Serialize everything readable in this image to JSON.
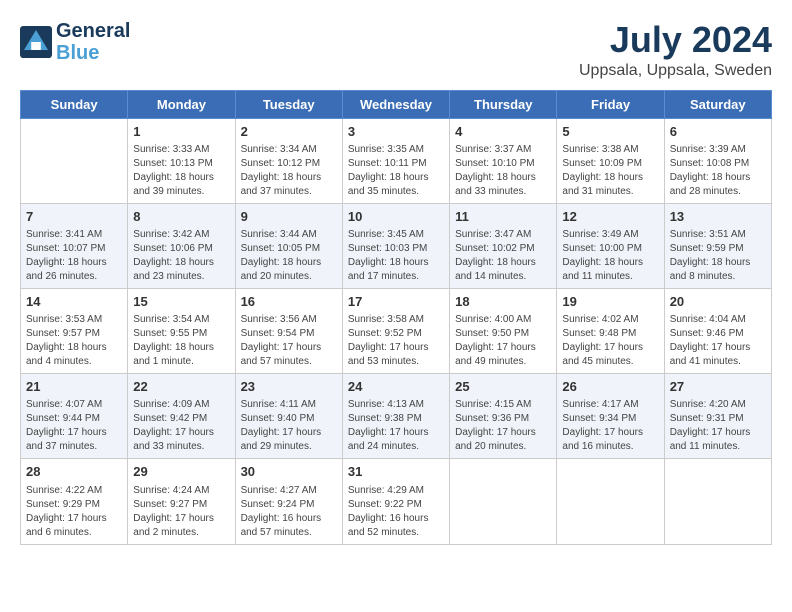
{
  "header": {
    "logo_line1": "General",
    "logo_line2": "Blue",
    "month_year": "July 2024",
    "location": "Uppsala, Uppsala, Sweden"
  },
  "weekdays": [
    "Sunday",
    "Monday",
    "Tuesday",
    "Wednesday",
    "Thursday",
    "Friday",
    "Saturday"
  ],
  "weeks": [
    [
      {
        "day": "",
        "info": ""
      },
      {
        "day": "1",
        "info": "Sunrise: 3:33 AM\nSunset: 10:13 PM\nDaylight: 18 hours\nand 39 minutes."
      },
      {
        "day": "2",
        "info": "Sunrise: 3:34 AM\nSunset: 10:12 PM\nDaylight: 18 hours\nand 37 minutes."
      },
      {
        "day": "3",
        "info": "Sunrise: 3:35 AM\nSunset: 10:11 PM\nDaylight: 18 hours\nand 35 minutes."
      },
      {
        "day": "4",
        "info": "Sunrise: 3:37 AM\nSunset: 10:10 PM\nDaylight: 18 hours\nand 33 minutes."
      },
      {
        "day": "5",
        "info": "Sunrise: 3:38 AM\nSunset: 10:09 PM\nDaylight: 18 hours\nand 31 minutes."
      },
      {
        "day": "6",
        "info": "Sunrise: 3:39 AM\nSunset: 10:08 PM\nDaylight: 18 hours\nand 28 minutes."
      }
    ],
    [
      {
        "day": "7",
        "info": "Sunrise: 3:41 AM\nSunset: 10:07 PM\nDaylight: 18 hours\nand 26 minutes."
      },
      {
        "day": "8",
        "info": "Sunrise: 3:42 AM\nSunset: 10:06 PM\nDaylight: 18 hours\nand 23 minutes."
      },
      {
        "day": "9",
        "info": "Sunrise: 3:44 AM\nSunset: 10:05 PM\nDaylight: 18 hours\nand 20 minutes."
      },
      {
        "day": "10",
        "info": "Sunrise: 3:45 AM\nSunset: 10:03 PM\nDaylight: 18 hours\nand 17 minutes."
      },
      {
        "day": "11",
        "info": "Sunrise: 3:47 AM\nSunset: 10:02 PM\nDaylight: 18 hours\nand 14 minutes."
      },
      {
        "day": "12",
        "info": "Sunrise: 3:49 AM\nSunset: 10:00 PM\nDaylight: 18 hours\nand 11 minutes."
      },
      {
        "day": "13",
        "info": "Sunrise: 3:51 AM\nSunset: 9:59 PM\nDaylight: 18 hours\nand 8 minutes."
      }
    ],
    [
      {
        "day": "14",
        "info": "Sunrise: 3:53 AM\nSunset: 9:57 PM\nDaylight: 18 hours\nand 4 minutes."
      },
      {
        "day": "15",
        "info": "Sunrise: 3:54 AM\nSunset: 9:55 PM\nDaylight: 18 hours\nand 1 minute."
      },
      {
        "day": "16",
        "info": "Sunrise: 3:56 AM\nSunset: 9:54 PM\nDaylight: 17 hours\nand 57 minutes."
      },
      {
        "day": "17",
        "info": "Sunrise: 3:58 AM\nSunset: 9:52 PM\nDaylight: 17 hours\nand 53 minutes."
      },
      {
        "day": "18",
        "info": "Sunrise: 4:00 AM\nSunset: 9:50 PM\nDaylight: 17 hours\nand 49 minutes."
      },
      {
        "day": "19",
        "info": "Sunrise: 4:02 AM\nSunset: 9:48 PM\nDaylight: 17 hours\nand 45 minutes."
      },
      {
        "day": "20",
        "info": "Sunrise: 4:04 AM\nSunset: 9:46 PM\nDaylight: 17 hours\nand 41 minutes."
      }
    ],
    [
      {
        "day": "21",
        "info": "Sunrise: 4:07 AM\nSunset: 9:44 PM\nDaylight: 17 hours\nand 37 minutes."
      },
      {
        "day": "22",
        "info": "Sunrise: 4:09 AM\nSunset: 9:42 PM\nDaylight: 17 hours\nand 33 minutes."
      },
      {
        "day": "23",
        "info": "Sunrise: 4:11 AM\nSunset: 9:40 PM\nDaylight: 17 hours\nand 29 minutes."
      },
      {
        "day": "24",
        "info": "Sunrise: 4:13 AM\nSunset: 9:38 PM\nDaylight: 17 hours\nand 24 minutes."
      },
      {
        "day": "25",
        "info": "Sunrise: 4:15 AM\nSunset: 9:36 PM\nDaylight: 17 hours\nand 20 minutes."
      },
      {
        "day": "26",
        "info": "Sunrise: 4:17 AM\nSunset: 9:34 PM\nDaylight: 17 hours\nand 16 minutes."
      },
      {
        "day": "27",
        "info": "Sunrise: 4:20 AM\nSunset: 9:31 PM\nDaylight: 17 hours\nand 11 minutes."
      }
    ],
    [
      {
        "day": "28",
        "info": "Sunrise: 4:22 AM\nSunset: 9:29 PM\nDaylight: 17 hours\nand 6 minutes."
      },
      {
        "day": "29",
        "info": "Sunrise: 4:24 AM\nSunset: 9:27 PM\nDaylight: 17 hours\nand 2 minutes."
      },
      {
        "day": "30",
        "info": "Sunrise: 4:27 AM\nSunset: 9:24 PM\nDaylight: 16 hours\nand 57 minutes."
      },
      {
        "day": "31",
        "info": "Sunrise: 4:29 AM\nSunset: 9:22 PM\nDaylight: 16 hours\nand 52 minutes."
      },
      {
        "day": "",
        "info": ""
      },
      {
        "day": "",
        "info": ""
      },
      {
        "day": "",
        "info": ""
      }
    ]
  ]
}
